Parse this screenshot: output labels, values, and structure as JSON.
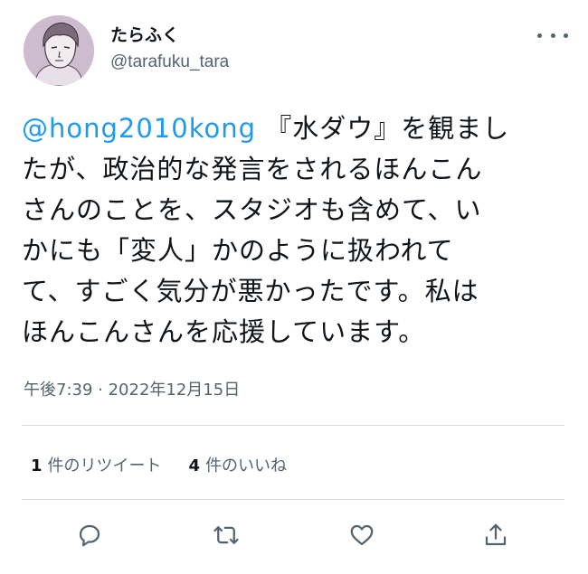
{
  "user": {
    "display_name": "たらふく",
    "handle": "@tarafuku_tara"
  },
  "tweet": {
    "mention": "@hong2010kong",
    "line1_rest": " 『水ダウ』を観まし",
    "lines": [
      "たが、政治的な発言をされるほんこん",
      "さんのことを、スタジオも含めて、い",
      "かにも「変人」かのように扱われて",
      "て、すごく気分が悪かったです。私は",
      "ほんこんさんを応援しています。"
    ],
    "timestamp": "午後7:39 · 2022年12月15日"
  },
  "stats": {
    "retweets_count": "1",
    "retweets_label": "件のリツイート",
    "likes_count": "4",
    "likes_label": "件のいいね"
  },
  "icons": {
    "avatar": "anime-portrait-avatar",
    "more": "more-icon",
    "reply": "reply-icon",
    "retweet": "retweet-icon",
    "like": "heart-icon",
    "share": "share-icon"
  },
  "colors": {
    "mention": "#1d9bf0",
    "secondary_text": "#536471",
    "divider": "#cfd9de"
  }
}
